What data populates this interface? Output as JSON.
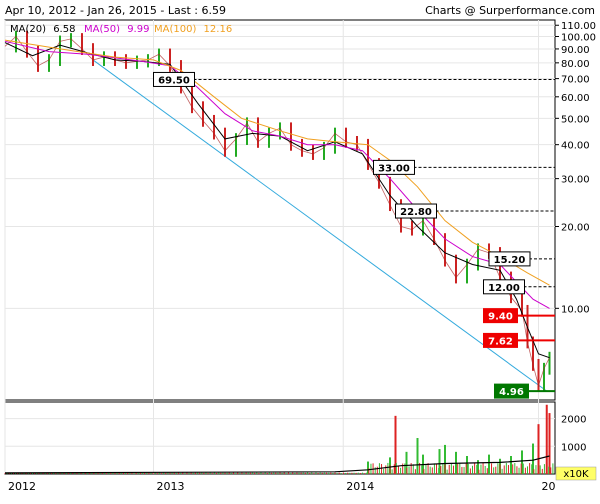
{
  "header": {
    "range_text": "Apr 10, 2012 - Jan 26, 2015 - Last : 6.59",
    "credit": "Charts @ Surperformance.com"
  },
  "legend": [
    {
      "label": "MA(20)",
      "value": "6.58",
      "color": "#000000"
    },
    {
      "label": "MA(50)",
      "value": "9.99",
      "color": "#cc00cc"
    },
    {
      "label": "MA(100)",
      "value": "12.16",
      "color": "#f0a020"
    }
  ],
  "chart_data": {
    "type": "line",
    "x_axis_labels": [
      "2012",
      "2013",
      "2014",
      "20"
    ],
    "y_scale": "log",
    "ylim": [
      4.6,
      115
    ],
    "y_ticks": [
      "110.00",
      "100.00",
      "90.00",
      "80.00",
      "70.00",
      "60.00",
      "50.00",
      "40.00",
      "30.00",
      "20.00",
      "10.00"
    ],
    "y_tick_values": [
      110,
      100,
      90,
      80,
      70,
      60,
      50,
      40,
      30,
      20,
      10
    ],
    "price_series": {
      "name": "Price",
      "points": [
        [
          0.0,
          92
        ],
        [
          0.02,
          100
        ],
        [
          0.04,
          88
        ],
        [
          0.06,
          78
        ],
        [
          0.08,
          82
        ],
        [
          0.1,
          96
        ],
        [
          0.12,
          98
        ],
        [
          0.14,
          90
        ],
        [
          0.16,
          82
        ],
        [
          0.18,
          84
        ],
        [
          0.2,
          82
        ],
        [
          0.22,
          80
        ],
        [
          0.24,
          81
        ],
        [
          0.26,
          82
        ],
        [
          0.28,
          86
        ],
        [
          0.3,
          78
        ],
        [
          0.32,
          65
        ],
        [
          0.34,
          55
        ],
        [
          0.36,
          49
        ],
        [
          0.38,
          44
        ],
        [
          0.4,
          38
        ],
        [
          0.42,
          42
        ],
        [
          0.44,
          48
        ],
        [
          0.46,
          41
        ],
        [
          0.48,
          44
        ],
        [
          0.5,
          46
        ],
        [
          0.52,
          40
        ],
        [
          0.54,
          38
        ],
        [
          0.56,
          37
        ],
        [
          0.58,
          39
        ],
        [
          0.6,
          44
        ],
        [
          0.62,
          41
        ],
        [
          0.64,
          40
        ],
        [
          0.66,
          34
        ],
        [
          0.68,
          29
        ],
        [
          0.7,
          24
        ],
        [
          0.72,
          20
        ],
        [
          0.74,
          19.5
        ],
        [
          0.76,
          21
        ],
        [
          0.78,
          18
        ],
        [
          0.8,
          15
        ],
        [
          0.82,
          13
        ],
        [
          0.84,
          14.5
        ],
        [
          0.86,
          16.5
        ],
        [
          0.88,
          16
        ],
        [
          0.9,
          13
        ],
        [
          0.92,
          11
        ],
        [
          0.94,
          9.8
        ],
        [
          0.95,
          7.5
        ],
        [
          0.96,
          6.2
        ],
        [
          0.97,
          5.2
        ],
        [
          0.98,
          6.0
        ],
        [
          0.99,
          6.59
        ]
      ]
    },
    "ma_series": [
      {
        "name": "MA(20)",
        "color": "#000000",
        "points": [
          [
            0.0,
            95
          ],
          [
            0.05,
            85
          ],
          [
            0.1,
            93
          ],
          [
            0.15,
            87
          ],
          [
            0.2,
            82
          ],
          [
            0.25,
            81
          ],
          [
            0.3,
            79
          ],
          [
            0.35,
            57
          ],
          [
            0.4,
            42
          ],
          [
            0.45,
            44
          ],
          [
            0.5,
            43
          ],
          [
            0.55,
            38
          ],
          [
            0.6,
            41
          ],
          [
            0.65,
            37
          ],
          [
            0.7,
            26
          ],
          [
            0.75,
            20
          ],
          [
            0.8,
            16
          ],
          [
            0.85,
            14.5
          ],
          [
            0.9,
            13.8
          ],
          [
            0.93,
            10.8
          ],
          [
            0.95,
            8.5
          ],
          [
            0.97,
            6.8
          ],
          [
            0.99,
            6.58
          ]
        ]
      },
      {
        "name": "MA(50)",
        "color": "#cc00cc",
        "points": [
          [
            0.0,
            96
          ],
          [
            0.08,
            88
          ],
          [
            0.15,
            86
          ],
          [
            0.25,
            81
          ],
          [
            0.3,
            78
          ],
          [
            0.35,
            65
          ],
          [
            0.4,
            52
          ],
          [
            0.45,
            45
          ],
          [
            0.5,
            43
          ],
          [
            0.55,
            40
          ],
          [
            0.6,
            40
          ],
          [
            0.65,
            38
          ],
          [
            0.7,
            30
          ],
          [
            0.75,
            23
          ],
          [
            0.8,
            18
          ],
          [
            0.85,
            15.5
          ],
          [
            0.9,
            14.5
          ],
          [
            0.93,
            12.5
          ],
          [
            0.96,
            10.8
          ],
          [
            0.99,
            9.99
          ]
        ]
      },
      {
        "name": "MA(100)",
        "color": "#f0a020",
        "points": [
          [
            0.0,
            97
          ],
          [
            0.1,
            90
          ],
          [
            0.2,
            84
          ],
          [
            0.27,
            82
          ],
          [
            0.32,
            75
          ],
          [
            0.38,
            60
          ],
          [
            0.43,
            50
          ],
          [
            0.5,
            45
          ],
          [
            0.55,
            42
          ],
          [
            0.6,
            41
          ],
          [
            0.66,
            40
          ],
          [
            0.7,
            35
          ],
          [
            0.75,
            28
          ],
          [
            0.8,
            21
          ],
          [
            0.85,
            17.5
          ],
          [
            0.9,
            15.5
          ],
          [
            0.95,
            13.5
          ],
          [
            0.99,
            12.16
          ]
        ]
      }
    ],
    "trendline": {
      "color": "#33aadd",
      "points": [
        [
          0.16,
          82
        ],
        [
          0.985,
          4.96
        ]
      ]
    },
    "annotations": [
      {
        "label": "69.50",
        "value": 69.5,
        "style": "dashed",
        "x_start": 0.27
      },
      {
        "label": "33.00",
        "value": 33.0,
        "style": "dashed",
        "x_start": 0.67
      },
      {
        "label": "22.80",
        "value": 22.8,
        "style": "dashed",
        "x_start": 0.71
      },
      {
        "label": "15.20",
        "value": 15.2,
        "style": "dashed",
        "x_start": 0.88
      },
      {
        "label": "12.00",
        "value": 12.0,
        "style": "dashed",
        "x_start": 0.87
      },
      {
        "label": "9.40",
        "value": 9.4,
        "style": "red",
        "x_start": 0.87
      },
      {
        "label": "7.62",
        "value": 7.62,
        "style": "red",
        "x_start": 0.87
      },
      {
        "label": "4.96",
        "value": 4.96,
        "style": "green",
        "x_start": 0.89
      }
    ],
    "volume": {
      "ylim": [
        0,
        2600
      ],
      "y_ticks": [
        "2000",
        "1000"
      ],
      "y_tick_values": [
        2000,
        1000
      ],
      "unit_label": "x10K",
      "bars": [
        [
          0.66,
          450
        ],
        [
          0.7,
          600
        ],
        [
          0.71,
          2100
        ],
        [
          0.73,
          800
        ],
        [
          0.75,
          1300
        ],
        [
          0.76,
          700
        ],
        [
          0.79,
          900
        ],
        [
          0.8,
          1050
        ],
        [
          0.82,
          800
        ],
        [
          0.84,
          650
        ],
        [
          0.86,
          500
        ],
        [
          0.88,
          700
        ],
        [
          0.9,
          550
        ],
        [
          0.92,
          650
        ],
        [
          0.94,
          850
        ],
        [
          0.96,
          1100
        ],
        [
          0.97,
          1800
        ],
        [
          0.985,
          2500
        ],
        [
          0.99,
          2200
        ]
      ],
      "ma_points": [
        [
          0.0,
          40
        ],
        [
          0.3,
          60
        ],
        [
          0.6,
          80
        ],
        [
          0.66,
          150
        ],
        [
          0.72,
          300
        ],
        [
          0.8,
          380
        ],
        [
          0.9,
          420
        ],
        [
          0.96,
          500
        ],
        [
          0.99,
          650
        ]
      ]
    }
  }
}
